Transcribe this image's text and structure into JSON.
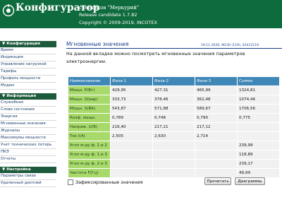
{
  "header": {
    "title": "Конфигуратор",
    "subtitle": "счетчиков \"Меркурий\"",
    "release": "Release candidate 1.7.82",
    "copyright": "Copyright © 2009-2019, INCOTEX"
  },
  "sidebar": {
    "sections": [
      {
        "label": "▼ Конфигурация",
        "items": [
          "Время",
          "Индикация",
          "Управление нагрузкой",
          "Тарифы",
          "Профиль мощности",
          "Модем"
        ]
      },
      {
        "label": "▼ Информация",
        "items": [
          "Служебная",
          "Слово состояния",
          "Энергия",
          "Мгновенные значения",
          "Журналы",
          "Максимумы мощности",
          "Учет технических потерь",
          "ПКЭ",
          "Отчеты"
        ]
      },
      {
        "label": "▼ Настройка",
        "items": [
          "Параметры связи",
          "Удаленный дисплей"
        ]
      }
    ]
  },
  "main": {
    "title": "Мгновенные значения",
    "meta": "19.11.2020, M230 (119), 42412119",
    "description": "На данной вкладке можно посмотреть мгновенные значения параметров электроэнергии.",
    "table": {
      "headers": [
        "Наименование",
        "Фаза-1",
        "Фаза-2",
        "Фаза-3",
        "Сумма"
      ],
      "rows": [
        [
          "Мощн. P(Вт)",
          "429,95",
          "427,31",
          "465,99",
          "1324,81"
        ],
        [
          "Мощн. Q(вар)",
          "333,73",
          "378,46",
          "362,48",
          "1074,46"
        ],
        [
          "Мощн. S(ВА)",
          "543,87",
          "571,88",
          "589,67",
          "1706,56"
        ],
        [
          "Коэф. мощн.",
          "0,789",
          "0,748",
          "0,790",
          "0,775"
        ],
        [
          "Напряж. U(В)",
          "216,40",
          "217,21",
          "217,12",
          ""
        ],
        [
          "Ток I(А)",
          "2,505",
          "2,630",
          "2,714",
          ""
        ],
        [
          "Угол м-ду ф. 1 и 2",
          "",
          "",
          "",
          "239,99"
        ],
        [
          "Угол м-ду ф. 1 и 3",
          "",
          "",
          "",
          "118,89"
        ],
        [
          "Угол м-ду ф. 2 и 3",
          "",
          "",
          "",
          "239,17"
        ],
        [
          "Частота F(Гц)",
          "",
          "",
          "",
          "49,99"
        ]
      ]
    },
    "fixed_label": "Зафиксированные значения",
    "read_button": "Прочитать",
    "diagrams_button": "Диаграммы"
  }
}
